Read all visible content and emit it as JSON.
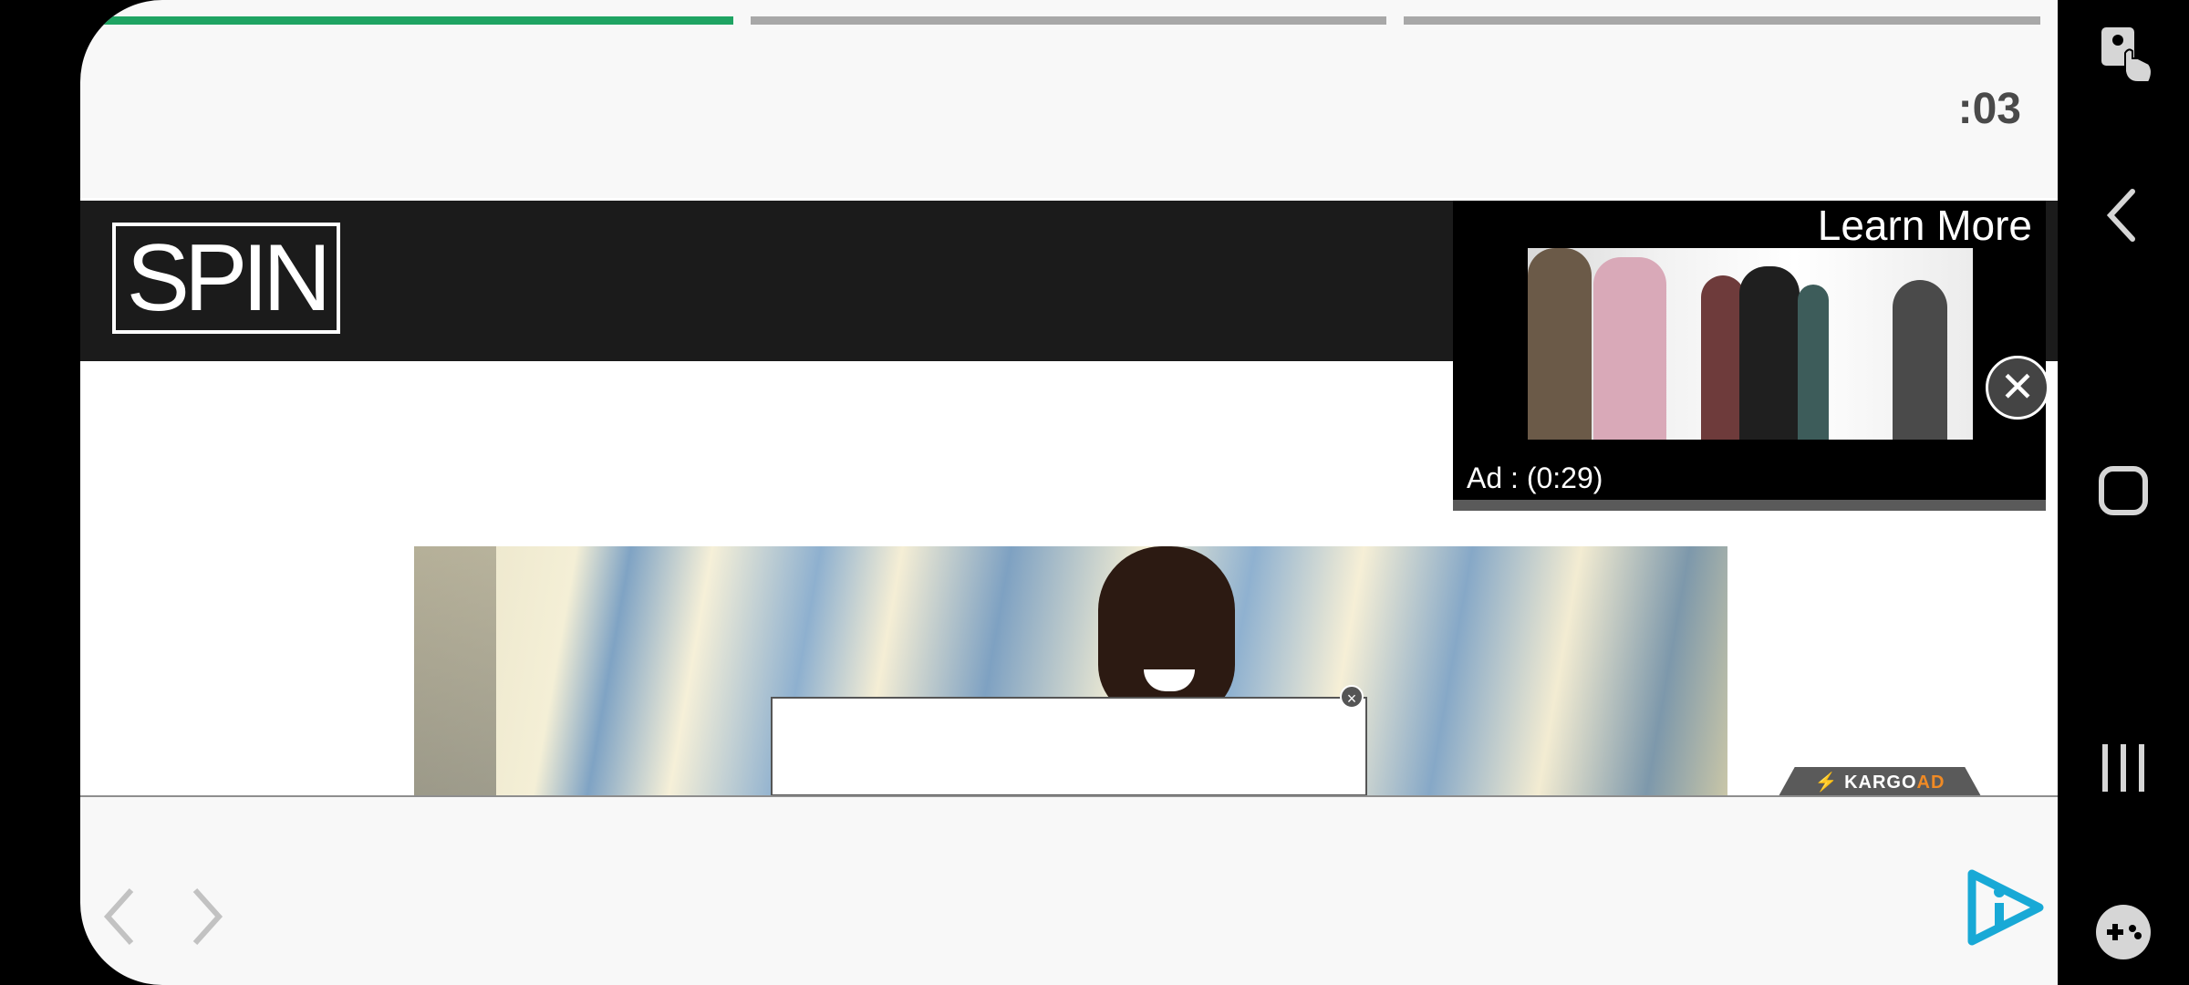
{
  "story": {
    "progress_segments": [
      {
        "state": "complete"
      },
      {
        "state": "pending"
      },
      {
        "state": "pending"
      }
    ],
    "timer": ":03"
  },
  "site": {
    "logo_text": "SPIN"
  },
  "video_ad": {
    "learn_more": "Learn More",
    "countdown": "Ad : (0:29)"
  },
  "badges": {
    "kargo_prefix": "KARGO",
    "kargo_suffix": "AD"
  },
  "icons": {
    "back": "chevron-left-icon",
    "forward": "chevron-right-icon",
    "brand": "play-info-icon",
    "system": [
      "accessibility-icon",
      "back-icon",
      "home-icon",
      "recents-icon",
      "game-tools-icon"
    ]
  },
  "colors": {
    "progress_active": "#1fa463",
    "progress_inactive": "#a8a8a8",
    "brand_icon": "#18a9d6",
    "kargo_accent": "#f08a24",
    "header_bg": "#1b1b1b"
  }
}
